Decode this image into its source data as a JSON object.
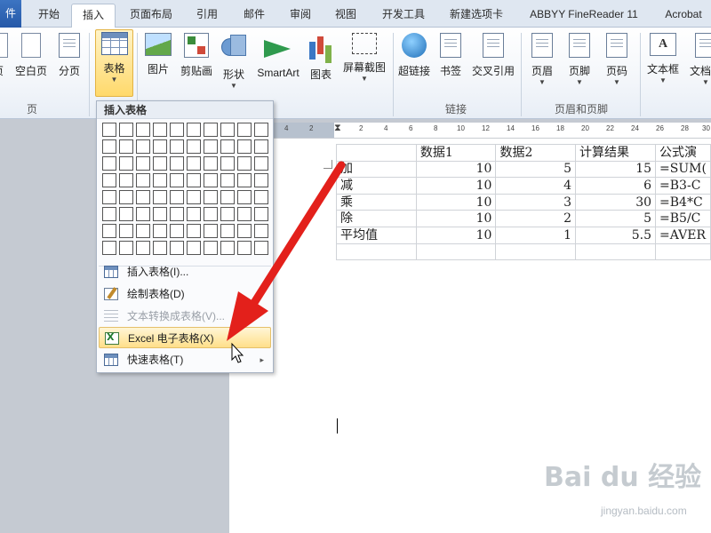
{
  "tabs": [
    {
      "label": "件",
      "active": false
    },
    {
      "label": "开始",
      "active": false
    },
    {
      "label": "插入",
      "active": true
    },
    {
      "label": "页面布局",
      "active": false
    },
    {
      "label": "引用",
      "active": false
    },
    {
      "label": "邮件",
      "active": false
    },
    {
      "label": "审阅",
      "active": false
    },
    {
      "label": "视图",
      "active": false
    },
    {
      "label": "开发工具",
      "active": false
    },
    {
      "label": "新建选项卡",
      "active": false
    },
    {
      "label": "ABBYY FineReader 11",
      "active": false
    },
    {
      "label": "Acrobat",
      "active": false
    }
  ],
  "ribbon": {
    "buttons": {
      "cover": "页",
      "blank": "空白页",
      "break": "分页",
      "table": "表格",
      "picture": "图片",
      "clipart": "剪贴画",
      "shapes": "形状",
      "smartart": "SmartArt",
      "chart": "图表",
      "screenshot": "屏幕截图",
      "hyperlink": "超链接",
      "bookmark": "书签",
      "crossref": "交叉引用",
      "header": "页眉",
      "footer": "页脚",
      "pagenum": "页码",
      "textbox": "文本框",
      "docparts": "文档部"
    },
    "groups": {
      "pages": "页",
      "links": "链接",
      "headerfooter": "页眉和页脚"
    }
  },
  "ruler_ticks": [
    "4",
    "2",
    "2",
    "4",
    "6",
    "8",
    "10",
    "12",
    "14",
    "16",
    "18",
    "20",
    "22",
    "24",
    "26",
    "28",
    "30"
  ],
  "table_menu": {
    "title": "插入表格",
    "grid_cols": 10,
    "grid_rows": 8,
    "items": [
      {
        "label": "插入表格(I)...",
        "disabled": false,
        "hover": false
      },
      {
        "label": "绘制表格(D)",
        "disabled": false,
        "hover": false
      },
      {
        "label": "文本转换成表格(V)...",
        "disabled": true,
        "hover": false
      },
      {
        "label": "Excel 电子表格(X)",
        "disabled": false,
        "hover": true
      },
      {
        "label": "快速表格(T)",
        "disabled": false,
        "hover": false,
        "submenu_arrow": "▸"
      }
    ]
  },
  "sheet": {
    "header": [
      "",
      "数据1",
      "数据2",
      "计算结果",
      "公式演"
    ],
    "rows": [
      [
        "加",
        "10",
        "5",
        "15",
        "=SUM("
      ],
      [
        "减",
        "10",
        "4",
        "6",
        "=B3-C"
      ],
      [
        "乘",
        "10",
        "3",
        "30",
        "=B4*C"
      ],
      [
        "除",
        "10",
        "2",
        "5",
        "=B5/C"
      ],
      [
        "平均值",
        "10",
        "1",
        "5.5",
        "=AVER"
      ],
      [
        "",
        "",
        "",
        "",
        ""
      ]
    ]
  },
  "watermark": {
    "main": "Bai du 经验",
    "sub": "jingyan.baidu.com"
  },
  "colors": {
    "arrow": "#e3201b",
    "highlight": "#ffdf8a",
    "tab_file": "#2659a8"
  }
}
